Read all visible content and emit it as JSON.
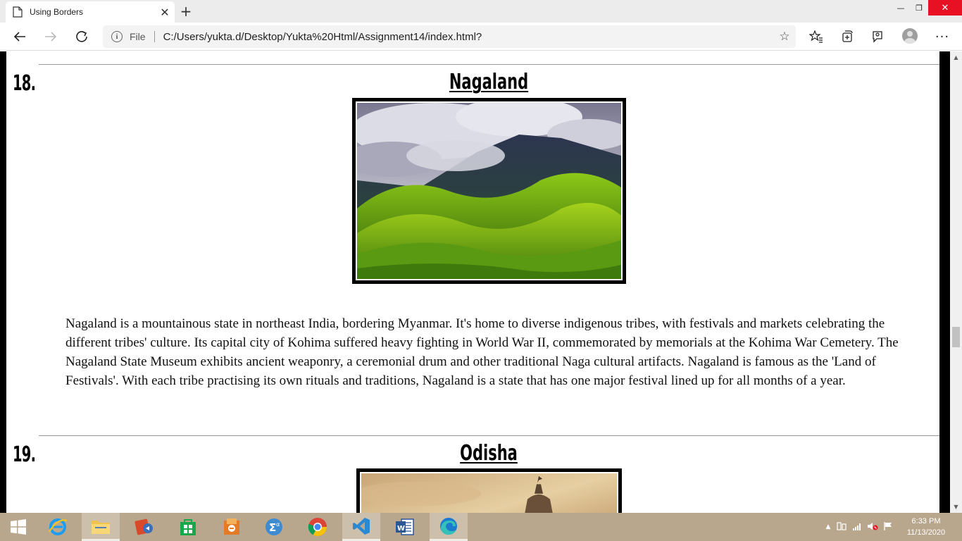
{
  "browser": {
    "tab_title": "Using Borders",
    "new_tab": "+",
    "address_scheme": "File",
    "address_url": "C:/Users/yukta.d/Desktop/Yukta%20Html/Assignment14/index.html?"
  },
  "page": {
    "sections": [
      {
        "number": "18.",
        "title": "Nagaland",
        "description": "Nagaland is a mountainous state in northeast India, bordering Myanmar. It's home to diverse indigenous tribes, with festivals and markets celebrating the different tribes' culture. Its capital city of Kohima suffered heavy fighting in World War II, commemorated by memorials at the Kohima War Cemetery. The Nagaland State Museum exhibits ancient weaponry, a ceremonial drum and other traditional Naga cultural artifacts. Nagaland is famous as the 'Land of Festivals'. With each tribe practising its own rituals and traditions, Nagaland is a state that has one major festival lined up for all months of a year."
      },
      {
        "number": "19.",
        "title": "Odisha"
      }
    ]
  },
  "taskbar": {
    "time": "6:33 PM",
    "date": "11/13/2020"
  },
  "colors": {
    "taskbar": "#b9a78d",
    "close_button": "#e81123"
  }
}
